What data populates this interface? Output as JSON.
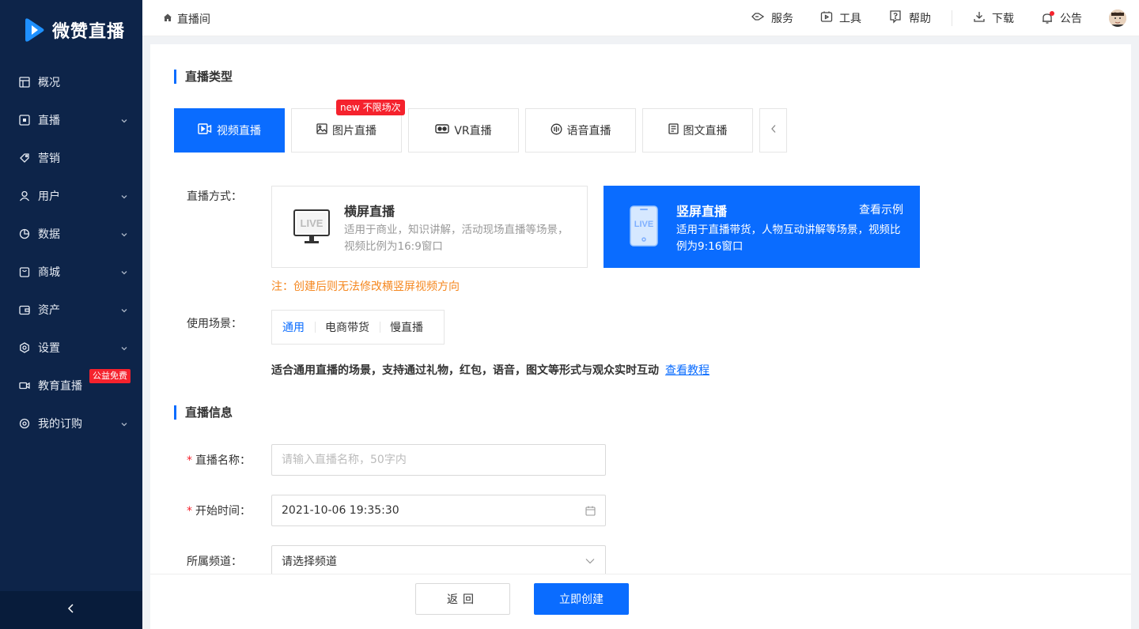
{
  "app": {
    "name": "微赞直播"
  },
  "sidebar": {
    "items": [
      {
        "label": "概况",
        "icon": "dashboard-icon",
        "has_children": false
      },
      {
        "label": "直播",
        "icon": "live-icon",
        "has_children": true
      },
      {
        "label": "营销",
        "icon": "tag-icon",
        "has_children": false
      },
      {
        "label": "用户",
        "icon": "user-icon",
        "has_children": true
      },
      {
        "label": "数据",
        "icon": "pie-chart-icon",
        "has_children": true
      },
      {
        "label": "商城",
        "icon": "shop-icon",
        "has_children": true
      },
      {
        "label": "资产",
        "icon": "wallet-icon",
        "has_children": true
      },
      {
        "label": "设置",
        "icon": "settings-icon",
        "has_children": true
      },
      {
        "label": "教育直播",
        "icon": "video-camera-icon",
        "has_children": false
      },
      {
        "label": "我的订购",
        "icon": "order-icon",
        "has_children": true
      }
    ],
    "free_badge": "公益免费"
  },
  "header": {
    "breadcrumb": "直播间",
    "actions": [
      {
        "label": "服务",
        "icon": "service-icon"
      },
      {
        "label": "工具",
        "icon": "tools-icon"
      },
      {
        "label": "帮助",
        "icon": "help-icon"
      },
      {
        "label": "下载",
        "icon": "download-icon"
      },
      {
        "label": "公告",
        "icon": "bell-icon"
      }
    ]
  },
  "live_type": {
    "title": "直播类型",
    "tabs": [
      {
        "label": "视频直播",
        "icon": "video-icon",
        "active": true
      },
      {
        "label": "图片直播",
        "icon": "image-icon",
        "active": false
      },
      {
        "label": "VR直播",
        "icon": "vr-icon",
        "active": false
      },
      {
        "label": "语音直播",
        "icon": "audio-icon",
        "active": false
      },
      {
        "label": "图文直播",
        "icon": "article-icon",
        "active": false
      }
    ],
    "new_badge": "new 不限场次"
  },
  "live_mode": {
    "label": "直播方式：",
    "options": [
      {
        "title": "横屏直播",
        "desc": "适用于商业，知识讲解，活动现场直播等场景，视频比例为16:9窗口",
        "selected": false
      },
      {
        "title": "竖屏直播",
        "desc": "适用于直播带货，人物互动讲解等场景，视频比例为9:16窗口",
        "selected": true,
        "link": "查看示例"
      }
    ],
    "icon_text": "LIVE",
    "note": "注：创建后则无法修改横竖屏视频方向"
  },
  "scene": {
    "label": "使用场景：",
    "tabs": [
      "通用",
      "电商带货",
      "慢直播"
    ],
    "active_tab": "通用",
    "desc": "适合通用直播的场景，支持通过礼物，红包，语音，图文等形式与观众实时互动",
    "link": "查看教程"
  },
  "live_info": {
    "title": "直播信息",
    "name_label": "直播名称：",
    "name_placeholder": "请输入直播名称，50字内",
    "time_label": "开始时间：",
    "time_value": "2021-10-06 19:35:30",
    "channel_label": "所属频道：",
    "channel_placeholder": "请选择频道"
  },
  "footer": {
    "back": "返回",
    "create": "立即创建"
  },
  "colors": {
    "primary": "#0a6cff",
    "sidebar": "#0d2449",
    "danger": "#f5222d",
    "warning": "#f5871f"
  }
}
